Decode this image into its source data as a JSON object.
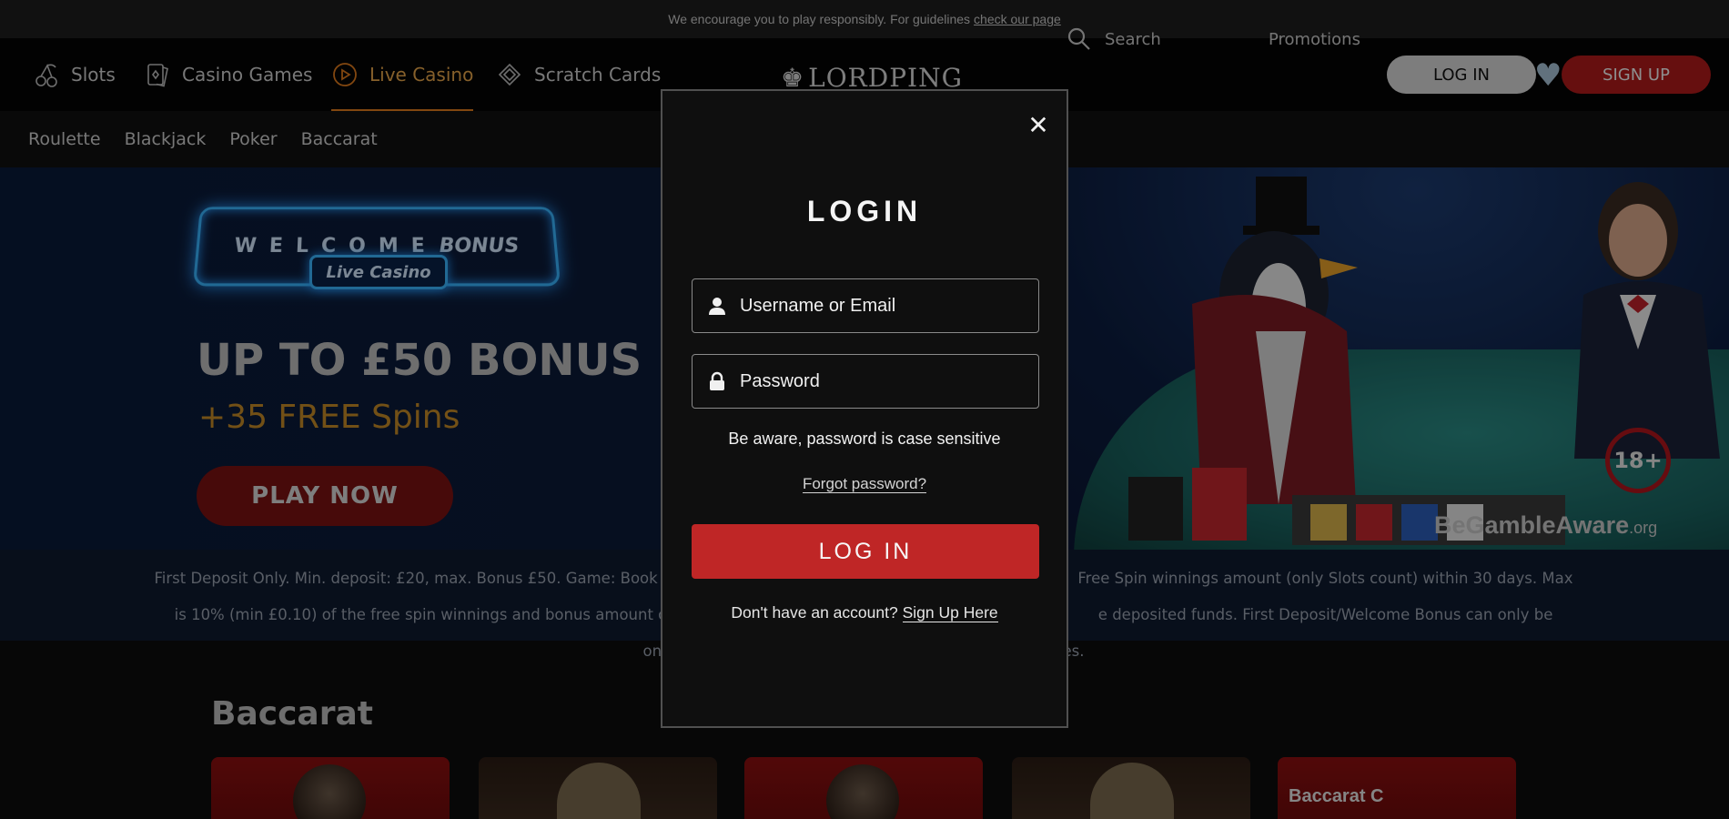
{
  "notice": {
    "text": "We encourage you to play responsibly. For guidelines",
    "link": "check our page"
  },
  "nav": {
    "items": [
      {
        "label": "Slots",
        "icon": "cherry-icon"
      },
      {
        "label": "Casino Games",
        "icon": "cards-icon"
      },
      {
        "label": "Live Casino",
        "icon": "play-circle-icon",
        "active": true
      },
      {
        "label": "Scratch Cards",
        "icon": "scratch-card-icon"
      }
    ],
    "logo": "LORDPING",
    "search_label": "Search",
    "promotions": "Promotions",
    "login": "LOG IN",
    "signup": "SIGN UP"
  },
  "subnav": [
    "Roulette",
    "Blackjack",
    "Poker",
    "Baccarat"
  ],
  "hero": {
    "welcome": "WELCOME",
    "bonus_word": "BONUS",
    "tag": "Live Casino",
    "headline": "UP TO £50 BONUS",
    "subline": "+35 FREE Spins",
    "cta": "PLAY NOW",
    "age": "18+",
    "gamble_aware": "BeGambleAware",
    "gamble_aware_suffix": ".org"
  },
  "terms": {
    "line1": "First Deposit Only. Min. deposit: £20, max. Bonus £50. Game: Book of",
    "line1_right": "Free Spin winnings amount (only Slots count) within 30 days. Max bet",
    "line2": "is 10% (min £0.10) of the free spin winnings and bonus amount or £5",
    "line2_right": "e deposited funds. First Deposit/Welcome Bonus can only be claimed",
    "line3": "on",
    "line3_right": "es."
  },
  "section": {
    "title": "Baccarat",
    "thumb_label": "Baccarat C"
  },
  "modal": {
    "title": "LOGIN",
    "username_placeholder": "Username or Email",
    "password_placeholder": "Password",
    "notice": "Be aware, password is case sensitive",
    "forgot": "Forgot password?",
    "login": "LOG IN",
    "no_account": "Don't have an account?",
    "signup_link": "Sign Up Here",
    "close": "✕"
  },
  "colors": {
    "accent_orange": "#e07b1d",
    "brand_red": "#bf2626",
    "signup_red": "#b01b1b",
    "bonus_gold": "#c58a26"
  }
}
